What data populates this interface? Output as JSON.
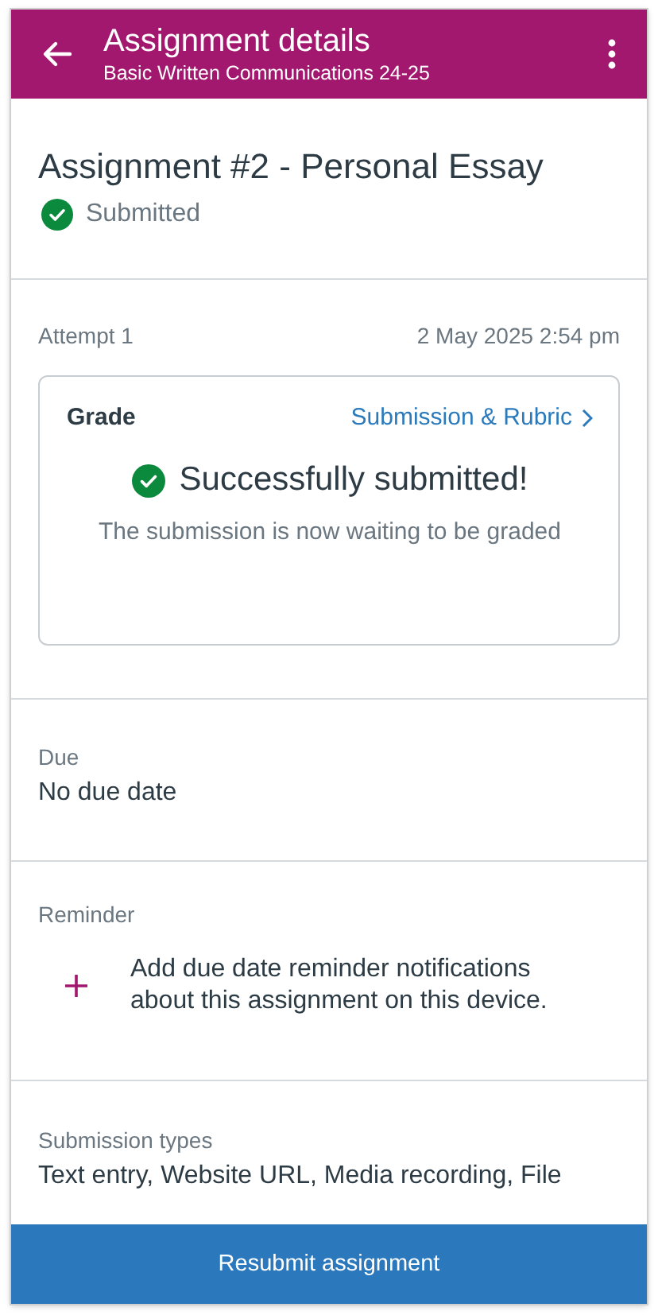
{
  "header": {
    "title": "Assignment details",
    "subtitle": "Basic Written Communications 24-25"
  },
  "assignment": {
    "title": "Assignment #2 - Personal Essay",
    "status": "Submitted"
  },
  "attempt": {
    "label": "Attempt 1",
    "date": "2 May 2025 2:54 pm"
  },
  "grade_card": {
    "label": "Grade",
    "link": "Submission & Rubric",
    "message": "Successfully submitted!",
    "note": "The submission is now waiting to be graded"
  },
  "due": {
    "label": "Due",
    "value": "No due date"
  },
  "reminder": {
    "label": "Reminder",
    "text": "Add due date reminder notifications about this assignment on this device."
  },
  "submission_types": {
    "label": "Submission types",
    "value": "Text entry, Website URL, Media recording, File"
  },
  "primary_button": "Resubmit assignment"
}
